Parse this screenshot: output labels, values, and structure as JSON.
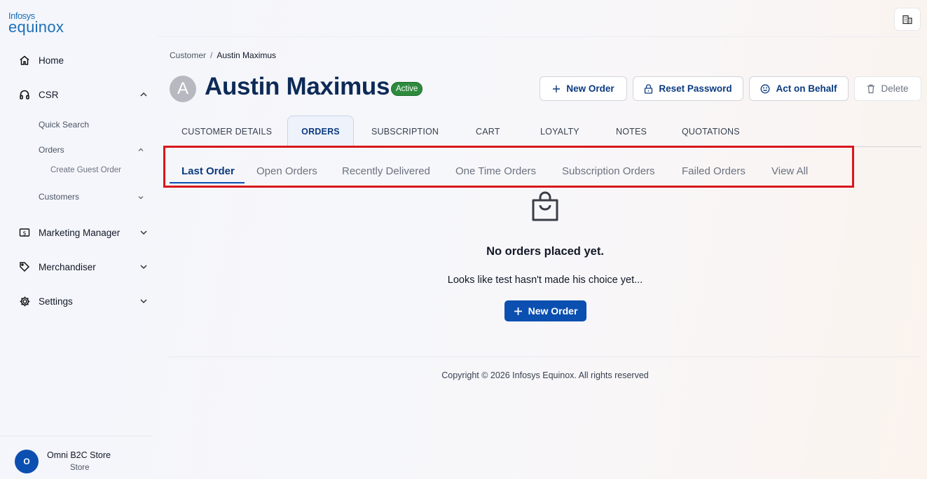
{
  "brand": {
    "line1": "Infosys",
    "line2": "equinox"
  },
  "sidebar": {
    "items": [
      {
        "label": "Home",
        "icon": "home-icon"
      },
      {
        "label": "CSR",
        "icon": "headset-icon",
        "expanded": true
      },
      {
        "label": "Marketing Manager",
        "icon": "dollar-icon"
      },
      {
        "label": "Merchandiser",
        "icon": "tag-icon"
      },
      {
        "label": "Settings",
        "icon": "gear-icon"
      }
    ],
    "csr_sub": {
      "quick_search": "Quick Search",
      "orders": "Orders",
      "create_guest_order": "Create Guest Order",
      "customers": "Customers"
    },
    "store": {
      "initial": "O",
      "name": "Omni B2C Store",
      "type": "Store"
    }
  },
  "breadcrumb": {
    "parent": "Customer",
    "separator": "/",
    "current": "Austin Maximus"
  },
  "customer": {
    "initial": "A",
    "name": "Austin Maximus",
    "status": "Active"
  },
  "actions": {
    "new_order": "New Order",
    "reset_password": "Reset Password",
    "act_on_behalf": "Act on Behalf",
    "delete": "Delete"
  },
  "main_tabs": [
    "CUSTOMER DETAILS",
    "ORDERS",
    "SUBSCRIPTION",
    "CART",
    "LOYALTY",
    "NOTES",
    "QUOTATIONS"
  ],
  "active_main_tab": "ORDERS",
  "order_tabs": [
    "Last Order",
    "Open Orders",
    "Recently Delivered",
    "One Time Orders",
    "Subscription Orders",
    "Failed Orders",
    "View All"
  ],
  "active_order_tab": "Last Order",
  "empty_state": {
    "title": "No orders placed yet.",
    "subtitle": "Looks like test hasn't made his choice yet...",
    "button": "New Order"
  },
  "footer": {
    "copyright": "Copyright © 2026 Infosys Equinox. All rights reserved"
  },
  "colors": {
    "primary": "#0b4fb0",
    "heading": "#0d2a57",
    "active_badge": "#2e8b3e",
    "highlight_box": "#d9161d"
  }
}
